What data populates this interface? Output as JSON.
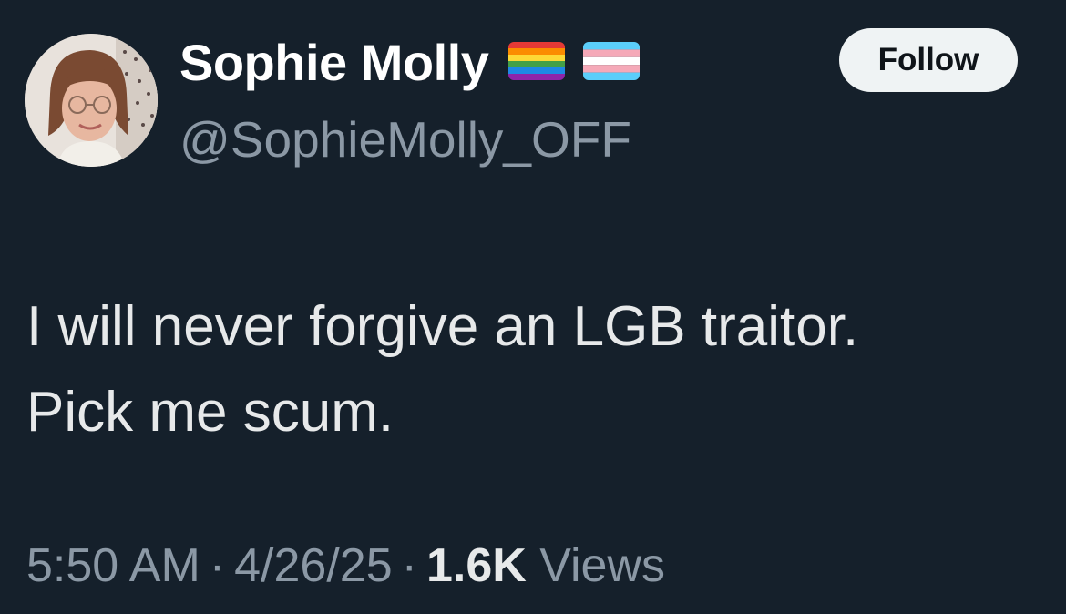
{
  "author": {
    "display_name": "Sophie Molly",
    "handle": "@SophieMolly_OFF",
    "flags": [
      "rainbow-flag-icon",
      "transgender-flag-icon"
    ]
  },
  "follow_button": {
    "label": "Follow"
  },
  "tweet": {
    "lines": [
      "I will never forgive an LGB traitor.",
      "Pick me scum."
    ]
  },
  "meta": {
    "time": "5:50 AM",
    "date": "4/26/25",
    "separator": "·",
    "views_count": "1.6K",
    "views_label": "Views"
  },
  "colors": {
    "background": "#15202b",
    "primary_text": "#e7e9ea",
    "secondary_text": "#8b98a5",
    "follow_bg": "#eff3f4"
  }
}
